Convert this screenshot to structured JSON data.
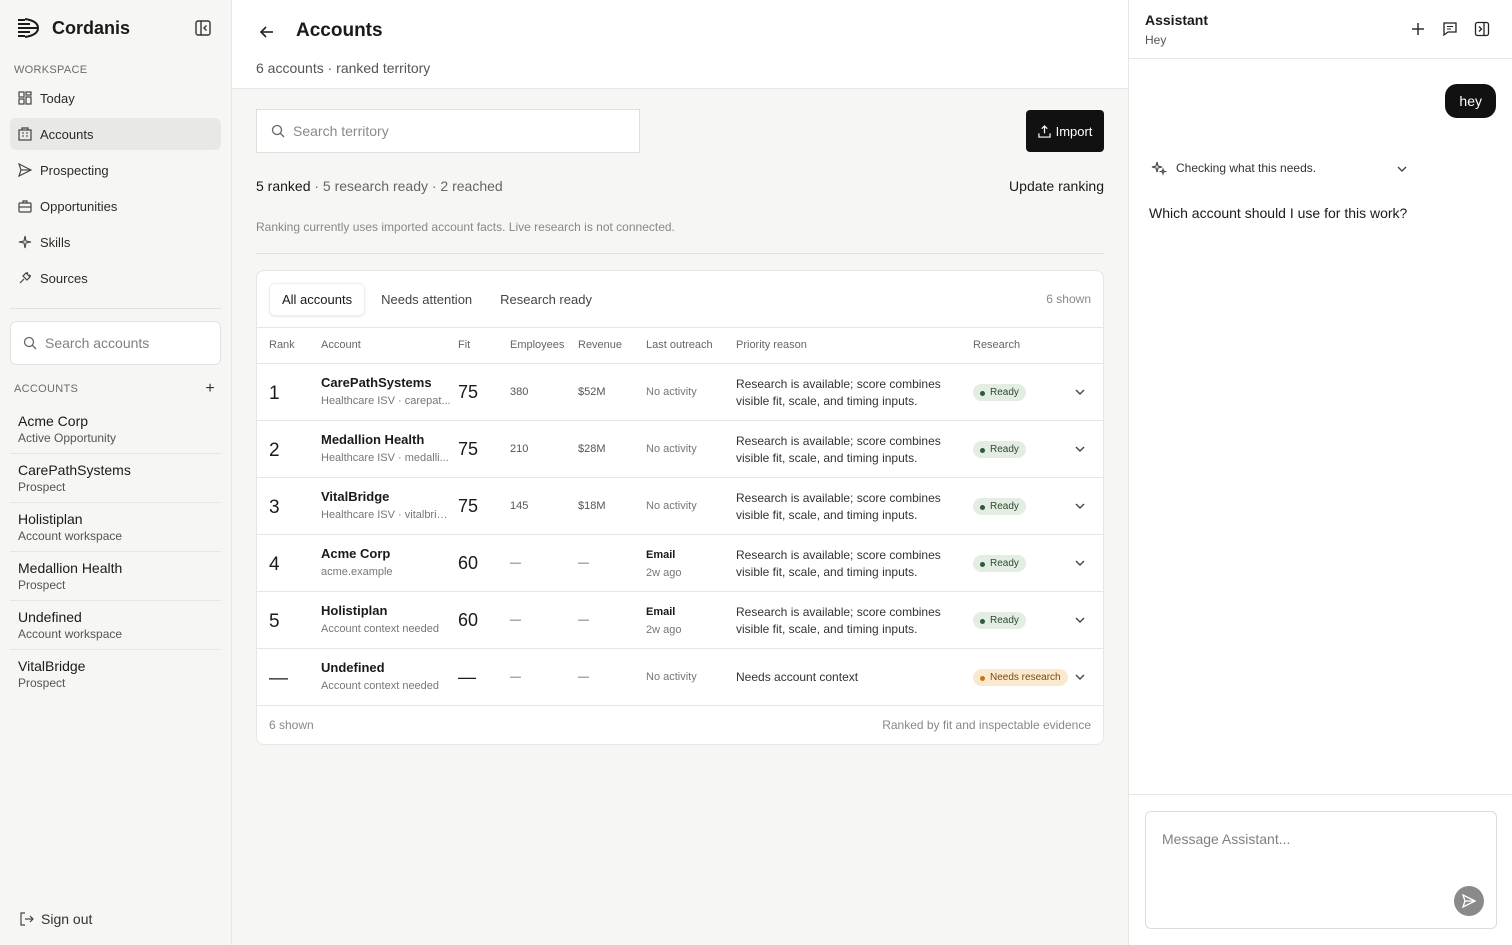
{
  "brand": {
    "name": "Cordanis"
  },
  "sidebar": {
    "workspace_label": "WORKSPACE",
    "nav": [
      {
        "label": "Today",
        "icon": "dashboard-icon",
        "active": false
      },
      {
        "label": "Accounts",
        "icon": "building-icon",
        "active": true
      },
      {
        "label": "Prospecting",
        "icon": "send-icon",
        "active": false
      },
      {
        "label": "Opportunities",
        "icon": "briefcase-icon",
        "active": false
      },
      {
        "label": "Skills",
        "icon": "sparkle-icon",
        "active": false
      },
      {
        "label": "Sources",
        "icon": "plug-icon",
        "active": false
      }
    ],
    "search_placeholder": "Search accounts",
    "accounts_label": "ACCOUNTS",
    "accounts": [
      {
        "name": "Acme Corp",
        "sub": "Active Opportunity"
      },
      {
        "name": "CarePathSystems",
        "sub": "Prospect"
      },
      {
        "name": "Holistiplan",
        "sub": "Account workspace"
      },
      {
        "name": "Medallion Health",
        "sub": "Prospect"
      },
      {
        "name": "Undefined",
        "sub": "Account workspace"
      },
      {
        "name": "VitalBridge",
        "sub": "Prospect"
      }
    ],
    "signout_label": "Sign out"
  },
  "main": {
    "title": "Accounts",
    "subtitle": "6 accounts · ranked territory",
    "search_placeholder": "Search territory",
    "import_label": "Import",
    "stats_strong": "5 ranked",
    "stats_rest": " · 5 research ready · 2 reached",
    "update_label": "Update ranking",
    "note": "Ranking currently uses imported account facts. Live research is not connected.",
    "tabs": [
      "All accounts",
      "Needs attention",
      "Research ready"
    ],
    "shown_count": "6 shown",
    "columns": {
      "rank": "Rank",
      "account": "Account",
      "fit": "Fit",
      "employees": "Employees",
      "revenue": "Revenue",
      "outreach": "Last outreach",
      "reason": "Priority reason",
      "research": "Research"
    },
    "rows": [
      {
        "rank": "1",
        "name": "CarePathSystems",
        "sub": "Healthcare ISV · carepat...",
        "fit": "75",
        "employees": "380",
        "revenue": "$52M",
        "outreach": "No activity",
        "reason": "Research is available; score combines visible fit, scale, and timing inputs.",
        "research": "Ready"
      },
      {
        "rank": "2",
        "name": "Medallion Health",
        "sub": "Healthcare ISV · medalli...",
        "fit": "75",
        "employees": "210",
        "revenue": "$28M",
        "outreach": "No activity",
        "reason": "Research is available; score combines visible fit, scale, and timing inputs.",
        "research": "Ready"
      },
      {
        "rank": "3",
        "name": "VitalBridge",
        "sub": "Healthcare ISV · vitalbrid...",
        "fit": "75",
        "employees": "145",
        "revenue": "$18M",
        "outreach": "No activity",
        "reason": "Research is available; score combines visible fit, scale, and timing inputs.",
        "research": "Ready"
      },
      {
        "rank": "4",
        "name": "Acme Corp",
        "sub": "acme.example",
        "fit": "60",
        "employees": "—",
        "revenue": "—",
        "outreach_type": "Email",
        "outreach_time": "2w ago",
        "reason": "Research is available; score combines visible fit, scale, and timing inputs.",
        "research": "Ready"
      },
      {
        "rank": "5",
        "name": "Holistiplan",
        "sub": "Account context needed",
        "fit": "60",
        "employees": "—",
        "revenue": "—",
        "outreach_type": "Email",
        "outreach_time": "2w ago",
        "reason": "Research is available; score combines visible fit, scale, and timing inputs.",
        "research": "Ready"
      },
      {
        "rank": "—",
        "name": "Undefined",
        "sub": "Account context needed",
        "fit": "—",
        "employees": "—",
        "revenue": "—",
        "outreach": "No activity",
        "reason": "Needs account context",
        "research": "Needs research"
      }
    ],
    "footer_left": "6 shown",
    "footer_right": "Ranked by fit and inspectable evidence"
  },
  "assistant": {
    "title": "Assistant",
    "subtitle": "Hey",
    "user_message": "hey",
    "thinking": "Checking what this needs.",
    "answer": "Which account should I use for this work?",
    "composer_placeholder": "Message Assistant..."
  },
  "colors": {
    "accent": "#111111",
    "ready_bg": "#e3ede3",
    "needs_bg": "#fbe9cf"
  }
}
